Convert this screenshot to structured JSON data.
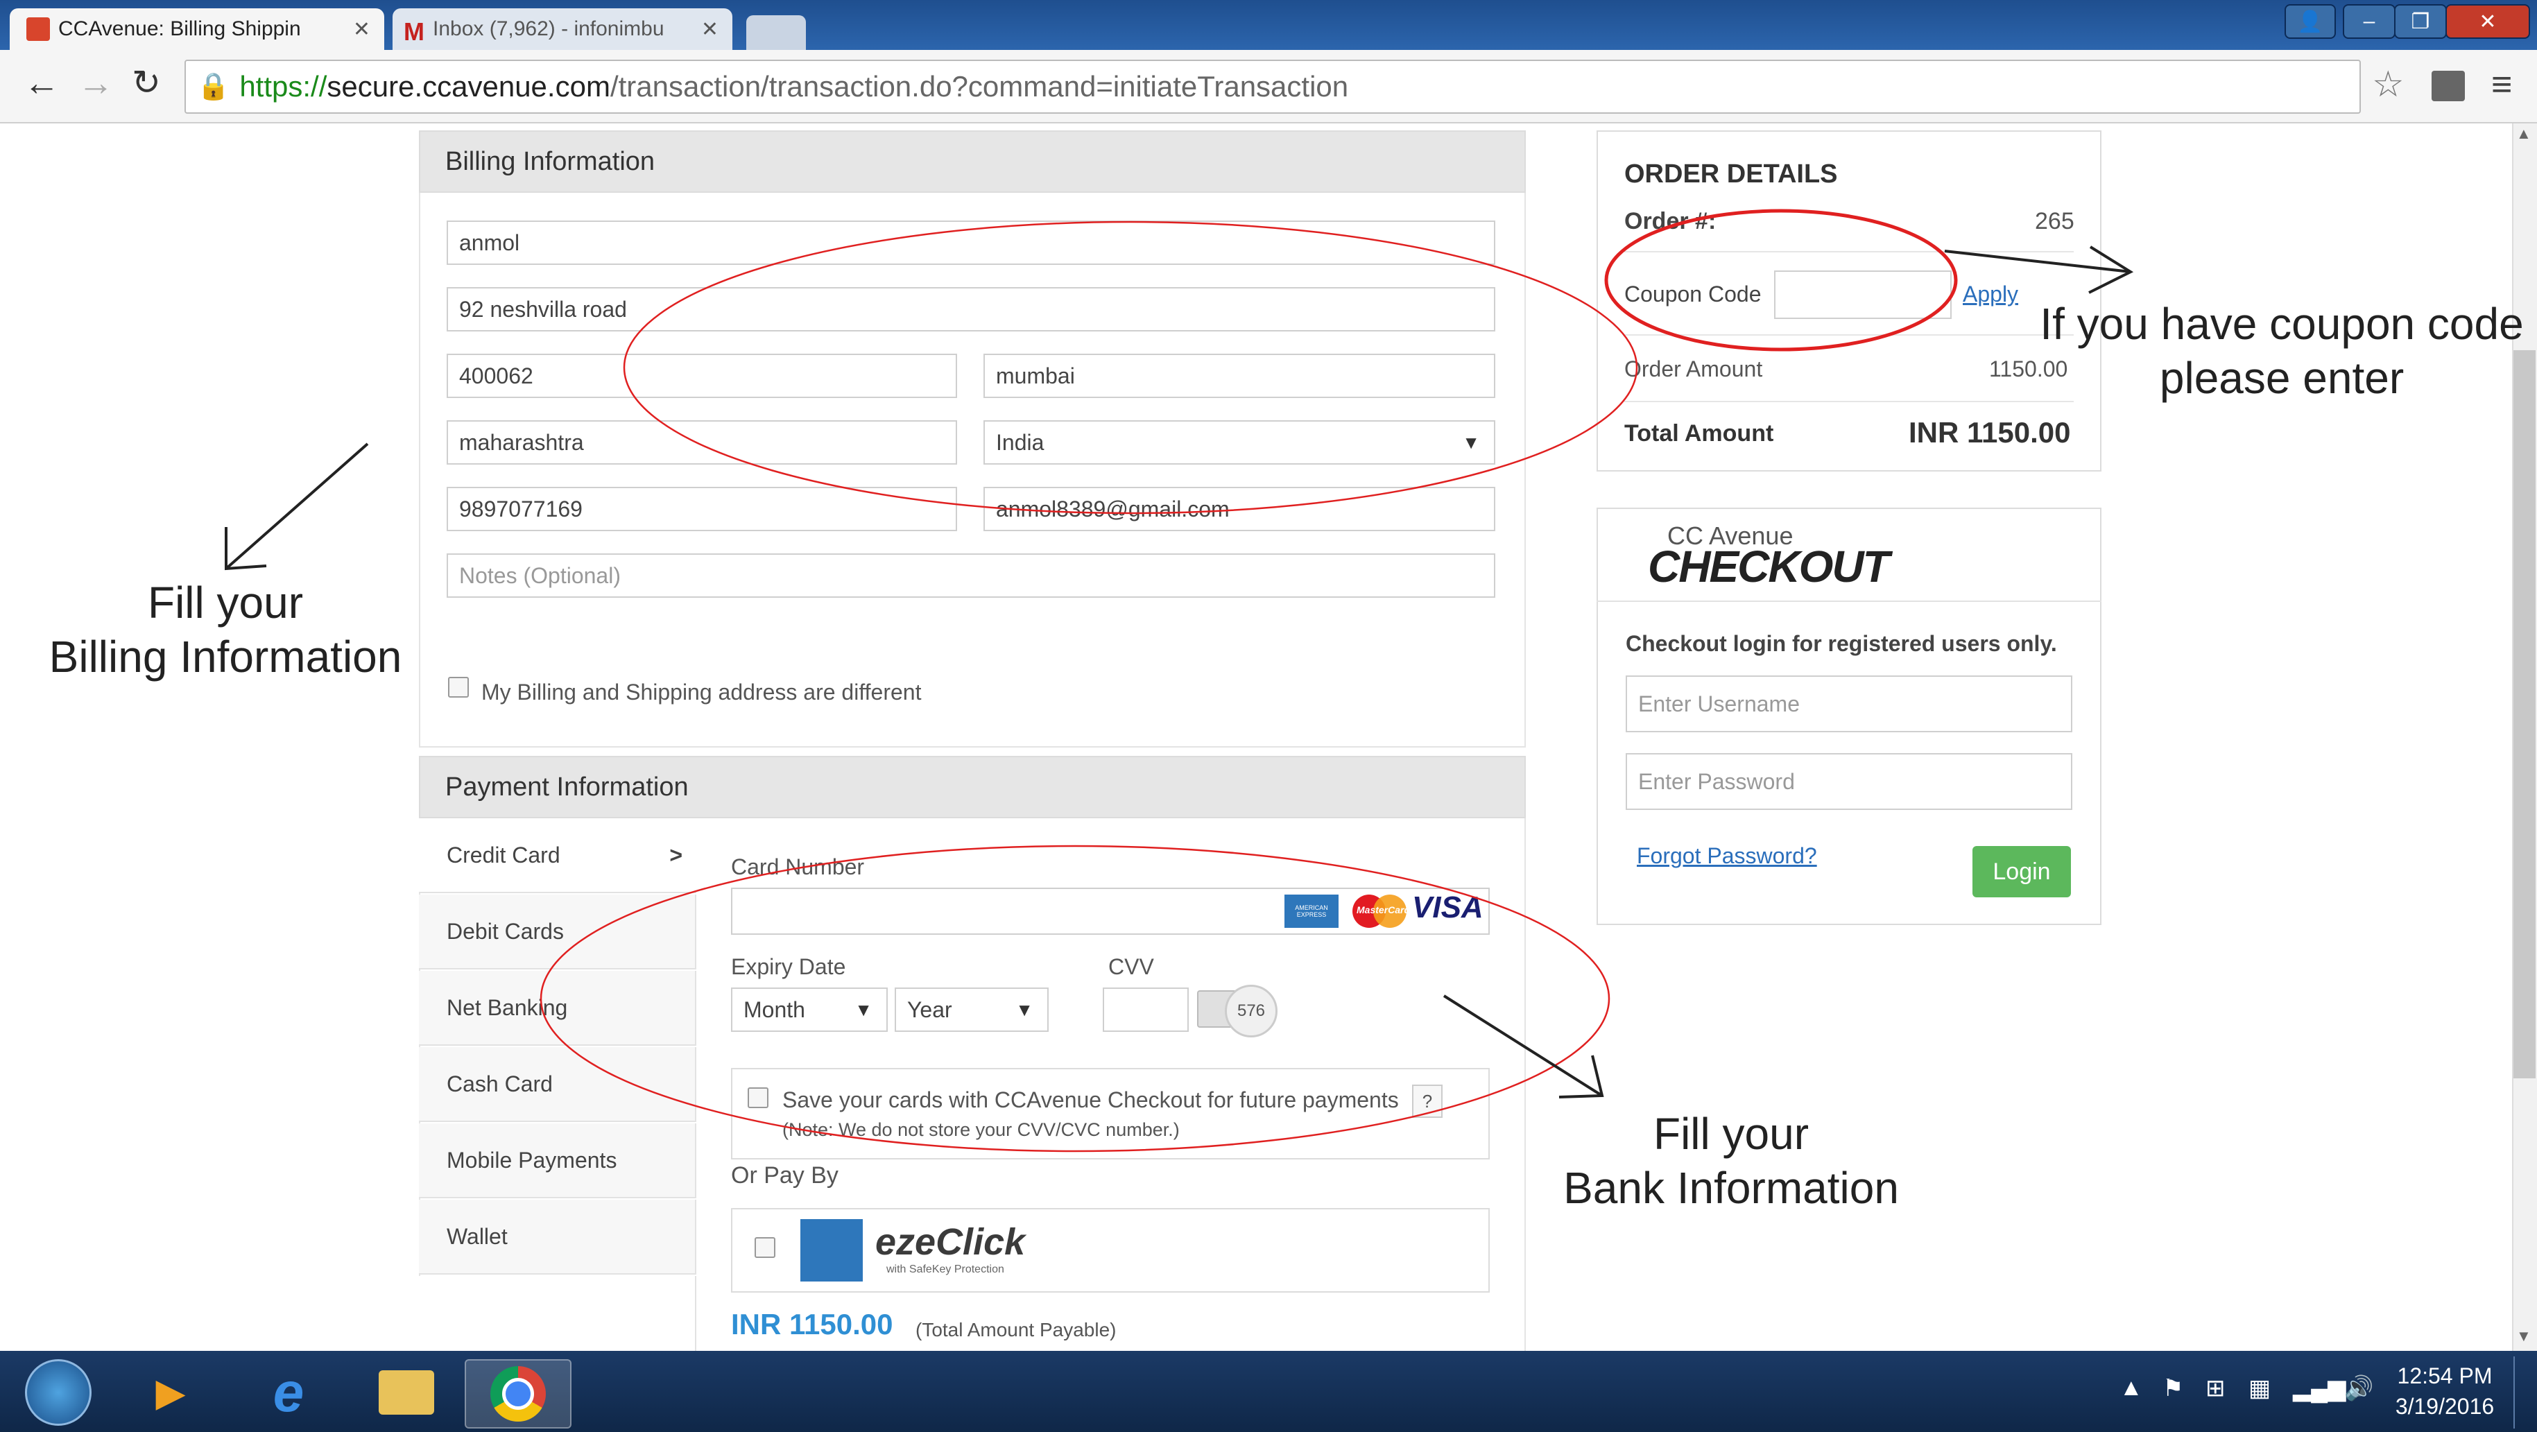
{
  "browser": {
    "tabs": [
      {
        "title": "CCAvenue: Billing Shippin",
        "active": true
      },
      {
        "title": "Inbox (7,962) - infonimbu",
        "active": false
      }
    ],
    "url_https": "https://",
    "url_rest_host": "secure.ccavenue.com",
    "url_rest_path": "/transaction/transaction.do?command=initiateTransaction"
  },
  "billing": {
    "header": "Billing Information",
    "name": "anmol",
    "address": "92 neshvilla road",
    "pincode": "400062",
    "city": "mumbai",
    "state": "maharashtra",
    "country": "India",
    "phone": "9897077169",
    "email": "anmol8389@gmail.com",
    "notes_placeholder": "Notes (Optional)",
    "different_label": "My Billing and Shipping address are different"
  },
  "payment": {
    "header": "Payment Information",
    "methods": [
      "Credit Card",
      "Debit Cards",
      "Net Banking",
      "Cash Card",
      "Mobile Payments",
      "Wallet"
    ],
    "active_arrow": ">",
    "card_number_label": "Card Number",
    "card_brands": [
      "AMERICAN EXPRESS",
      "MasterCard",
      "VISA"
    ],
    "expiry_label": "Expiry Date",
    "month": "Month",
    "year": "Year",
    "cvv_label": "CVV",
    "cvv_sample": "576",
    "save_cards_label": "Save your cards with CCAvenue Checkout for future payments",
    "save_help": "?",
    "save_note": "(Note: We do not store your CVV/CVC number.)",
    "or_pay_by": "Or Pay By",
    "ezeclick": "ezeClick",
    "ezeclick_sub": "with SafeKey Protection",
    "total": "INR 1150.00",
    "total_note": "(Total Amount Payable)"
  },
  "order": {
    "title": "ORDER DETAILS",
    "order_label": "Order #:",
    "order_no": "265",
    "coupon_label": "Coupon Code",
    "apply": "Apply",
    "amount_label": "Order Amount",
    "amount": "1150.00",
    "total_label": "Total Amount",
    "total": "INR 1150.00"
  },
  "checkout": {
    "brand_top": "CC Avenue",
    "brand_main": "CHECKOUT",
    "heading": "Checkout login for registered users only.",
    "username_placeholder": "Enter Username",
    "password_placeholder": "Enter Password",
    "forgot": "Forgot Password?",
    "login": "Login"
  },
  "annotations": {
    "billing_line1": "Fill your",
    "billing_line2": "Billing Information",
    "bank_line1": "Fill your",
    "bank_line2": "Bank Information",
    "coupon_line1": "If you have coupon code",
    "coupon_line2": "please enter"
  },
  "taskbar": {
    "time": "12:54 PM",
    "date": "3/19/2016"
  },
  "colors": {
    "accent_green": "#5cb85c",
    "link_blue": "#2a6ebb",
    "annotation_red": "#e02020",
    "total_blue": "#2f8fd4"
  }
}
